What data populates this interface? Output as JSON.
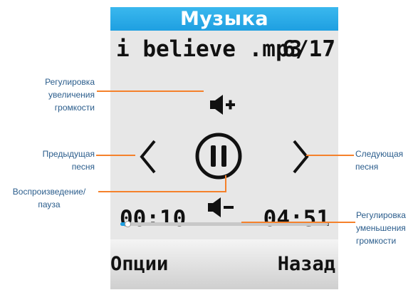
{
  "screen": {
    "title": "Музыка",
    "track_name": "i believe .mp3",
    "track_position": "6/17",
    "time_current": "00:10",
    "time_total": "04:51",
    "progress": 0.035,
    "softkey_left": "Опции",
    "softkey_right": "Назад",
    "accent_color": "#1e9fe1",
    "callout_color": "#f5812b",
    "icons": {
      "volume_up": "speaker-plus-icon",
      "volume_down": "speaker-minus-icon",
      "previous": "chevron-left-icon",
      "next": "chevron-right-icon",
      "play_pause": "pause-circle-icon"
    }
  },
  "callouts": {
    "volume_up": [
      "Регулировка",
      "увеличения",
      "громкости"
    ],
    "previous": [
      "Предыдущая",
      "песня"
    ],
    "play_pause": [
      "Воспроизведение/",
      "пауза"
    ],
    "next": [
      "Следующая",
      "песня"
    ],
    "volume_down": [
      "Регулировка",
      "уменьшения",
      "громкости"
    ]
  }
}
